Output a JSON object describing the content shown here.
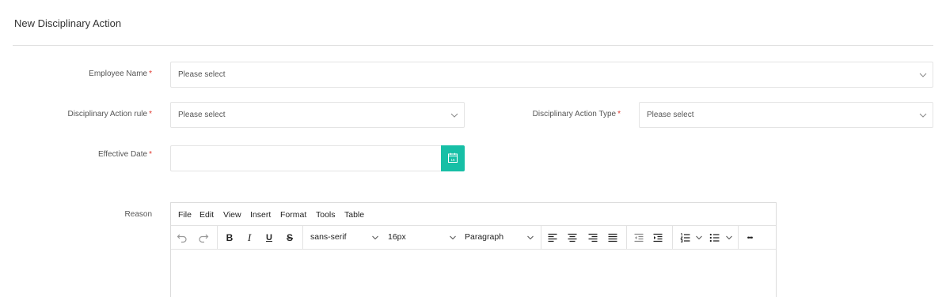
{
  "page": {
    "title": "New Disciplinary Action"
  },
  "form": {
    "employee_name": {
      "label": "Employee Name",
      "required": "*",
      "placeholder": "Please select"
    },
    "rule": {
      "label": "Disciplinary Action rule",
      "required": "*",
      "placeholder": "Please select"
    },
    "type": {
      "label": "Disciplinary Action Type",
      "required": "*",
      "placeholder": "Please select"
    },
    "effective_date": {
      "label": "Effective Date",
      "required": "*",
      "value": "",
      "calendar_icon_text": "15"
    },
    "reason": {
      "label": "Reason"
    }
  },
  "editor": {
    "menu": [
      "File",
      "Edit",
      "View",
      "Insert",
      "Format",
      "Tools",
      "Table"
    ],
    "toolbar": {
      "bold": "B",
      "italic": "I",
      "underline": "U",
      "strike": "S",
      "font_family": "sans-serif",
      "font_size": "16px",
      "block_format": "Paragraph",
      "more": "•••"
    }
  },
  "colors": {
    "accent": "#17bfa6",
    "required": "#e0352b",
    "border": "#e4e4e4"
  }
}
